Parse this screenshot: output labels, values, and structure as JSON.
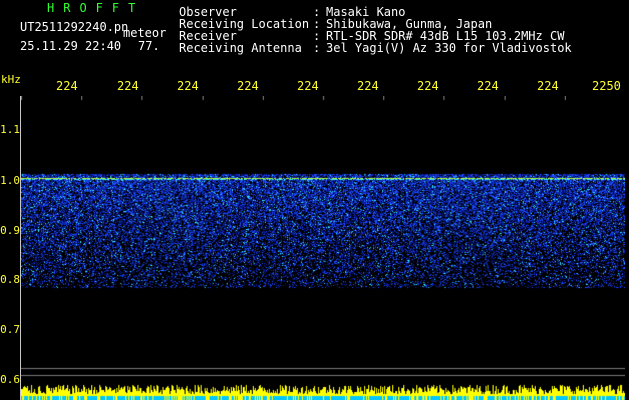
{
  "header": {
    "brand": "HROFFT",
    "filename": "UT2511292240.pn",
    "datetime": "25.11.29 22:40",
    "tag": "meteor",
    "count": "77."
  },
  "info": [
    {
      "label": "Observer",
      "colon": ":",
      "value": "Masaki Kano"
    },
    {
      "label": "Receiving Location",
      "colon": ":",
      "value": "Shibukawa, Gunma, Japan"
    },
    {
      "label": "Receiver",
      "colon": ":",
      "value": "RTL-SDR SDR# 43dB L15 103.2MHz CW"
    },
    {
      "label": "Receiving Antenna",
      "colon": ":",
      "value": "3el Yagi(V) Az 330 for Vladivostok"
    }
  ],
  "axis": {
    "y_unit": "kHz",
    "y_ticks": [
      "1.1",
      "1.0",
      "0.9",
      "0.8",
      "0.7",
      "0.6"
    ],
    "time_ticks": [
      "224",
      "224",
      "224",
      "224",
      "224",
      "224",
      "224",
      "224",
      "224",
      "2250"
    ]
  },
  "colors": {
    "background": "#000000",
    "axis_text": "#ffff33",
    "brand": "#33ff33",
    "signal_deep": "#0a1fa0",
    "signal_mid": "#1e4cff",
    "signal_hot": "#35e6ff",
    "carrier": "#b4ff3c",
    "level_bar": "#ffff00",
    "level_base": "#00c8ff"
  }
}
